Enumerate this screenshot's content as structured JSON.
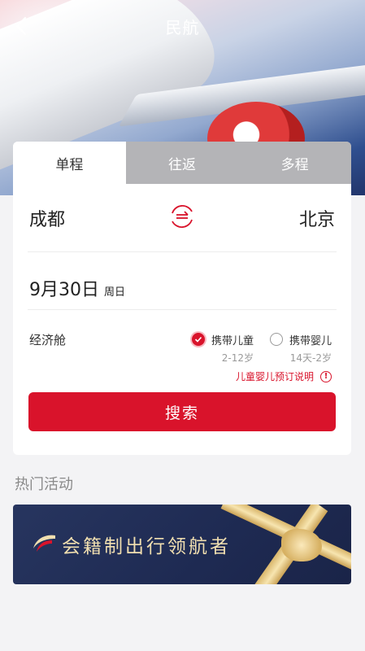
{
  "header": {
    "title": "民航"
  },
  "tabs": [
    {
      "label": "单程",
      "active": true
    },
    {
      "label": "往返",
      "active": false
    },
    {
      "label": "多程",
      "active": false
    }
  ],
  "route": {
    "from": "成都",
    "to": "北京"
  },
  "date": {
    "value": "9月30日",
    "weekday": "周日"
  },
  "cabin": {
    "label": "经济舱"
  },
  "passengers": [
    {
      "label": "携带儿童",
      "age": "2-12岁",
      "checked": true
    },
    {
      "label": "携带婴儿",
      "age": "14天-2岁",
      "checked": false
    }
  ],
  "note": {
    "text": "儿童婴儿预订说明",
    "icon_text": "!"
  },
  "search": {
    "label": "搜索"
  },
  "promotions": {
    "section_title": "热门活动",
    "banner_text": "会籍制出行领航者"
  },
  "colors": {
    "accent": "#d9132b",
    "banner_bg": "#1e2a52",
    "gold": "#f1dfb0"
  }
}
